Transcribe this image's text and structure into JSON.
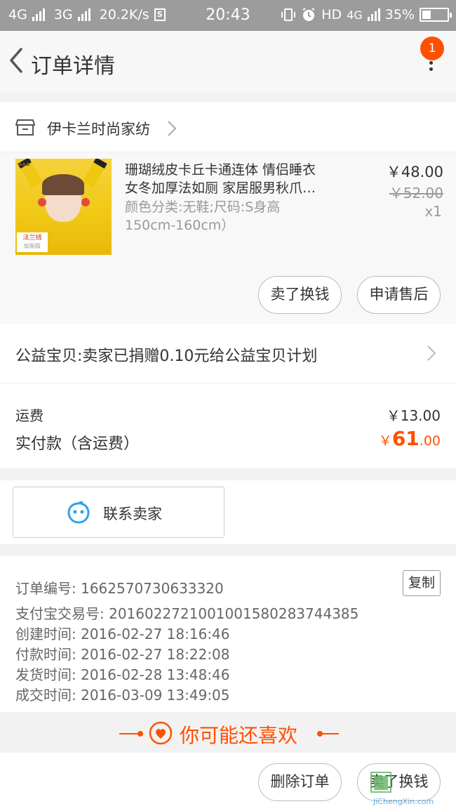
{
  "status_bar": {
    "sim1": "4G",
    "sim2": "3G",
    "speed": "20.2K/s",
    "s_icon_label": "S",
    "time": "20:43",
    "hd_label": "HD",
    "net_label": "4G",
    "battery_text": "35%",
    "battery_level": 0.35
  },
  "header": {
    "title": "订单详情",
    "badge_count": "1"
  },
  "shop": {
    "name": "伊卡兰时尚家纺"
  },
  "item": {
    "title_line1": "珊瑚绒皮卡丘卡通连体 情侣睡衣",
    "title_line2": "女冬加厚法如厕 家居服男秋爪…",
    "spec_line1": "颜色分类:无鞋;尺码:S身高",
    "spec_line2": "150cm-160cm）",
    "price": "￥48.00",
    "original_price": "￥52.00",
    "quantity": "x1",
    "image_tag": "法兰绒",
    "image_tag_sub": "如厕版",
    "sell_button": "卖了换钱",
    "after_sale_button": "申请售后"
  },
  "charity": {
    "text": "公益宝贝:卖家已捐赠0.10元给公益宝贝计划"
  },
  "fees": {
    "shipping_label": "运费",
    "shipping_value": "￥13.00",
    "total_label": "实付款（含运费）",
    "total_currency": "￥",
    "total_integer": "61",
    "total_decimal": ".00"
  },
  "contact": {
    "label": "联系卖家"
  },
  "order_info": {
    "copy_button": "复制",
    "order_no": "订单编号: 1662570730633320",
    "alipay_no": "支付宝交易号: 2016022721001001580283744385",
    "created": "创建时间: 2016-02-27 18:16:46",
    "paid": "付款时间: 2016-02-27 18:22:08",
    "shipped": "发货时间: 2016-02-28 13:48:46",
    "completed": "成交时间: 2016-03-09 13:49:05"
  },
  "may_like": {
    "title": "你可能还喜欢"
  },
  "bottom_bar": {
    "delete_button": "删除订单",
    "sell_button": "卖了换钱"
  },
  "watermark": {
    "text": "JiChengXin.com"
  },
  "colors": {
    "accent": "#ff5000",
    "statusbar": "#9c9c9c",
    "wangwang_blue": "#29a3ee"
  }
}
